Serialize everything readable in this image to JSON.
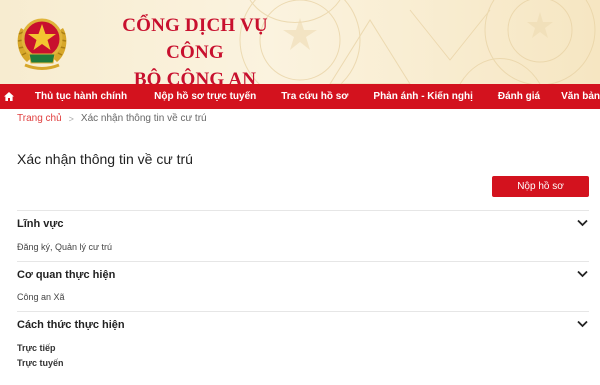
{
  "header": {
    "title_line1": "CỔNG DỊCH VỤ CÔNG",
    "title_line2": "BỘ CÔNG AN"
  },
  "nav": {
    "home_icon": "home-icon",
    "items": [
      {
        "label": "Thủ tục hành chính"
      },
      {
        "label": "Nộp hồ sơ trực tuyến"
      },
      {
        "label": "Tra cứu hồ sơ"
      },
      {
        "label": "Phản ánh - Kiến nghị"
      },
      {
        "label": "Đánh giá"
      },
      {
        "label": "Văn bản"
      }
    ]
  },
  "breadcrumb": {
    "home": "Trang chủ",
    "separator": ">",
    "current": "Xác nhận thông tin về cư trú"
  },
  "page": {
    "title": "Xác nhận thông tin về cư trú",
    "submit_label": "Nộp hồ sơ"
  },
  "sections": [
    {
      "title": "Lĩnh vực",
      "values": [
        "Đăng ký, Quản lý cư trú"
      ]
    },
    {
      "title": "Cơ quan thực hiện",
      "values": [
        "Công an Xã"
      ]
    },
    {
      "title": "Cách thức thực hiện",
      "values": [
        "Trực tiếp",
        "Trực tuyến"
      ]
    }
  ],
  "colors": {
    "brand_red": "#d3121e",
    "header_bg": "#f7ecd0"
  }
}
